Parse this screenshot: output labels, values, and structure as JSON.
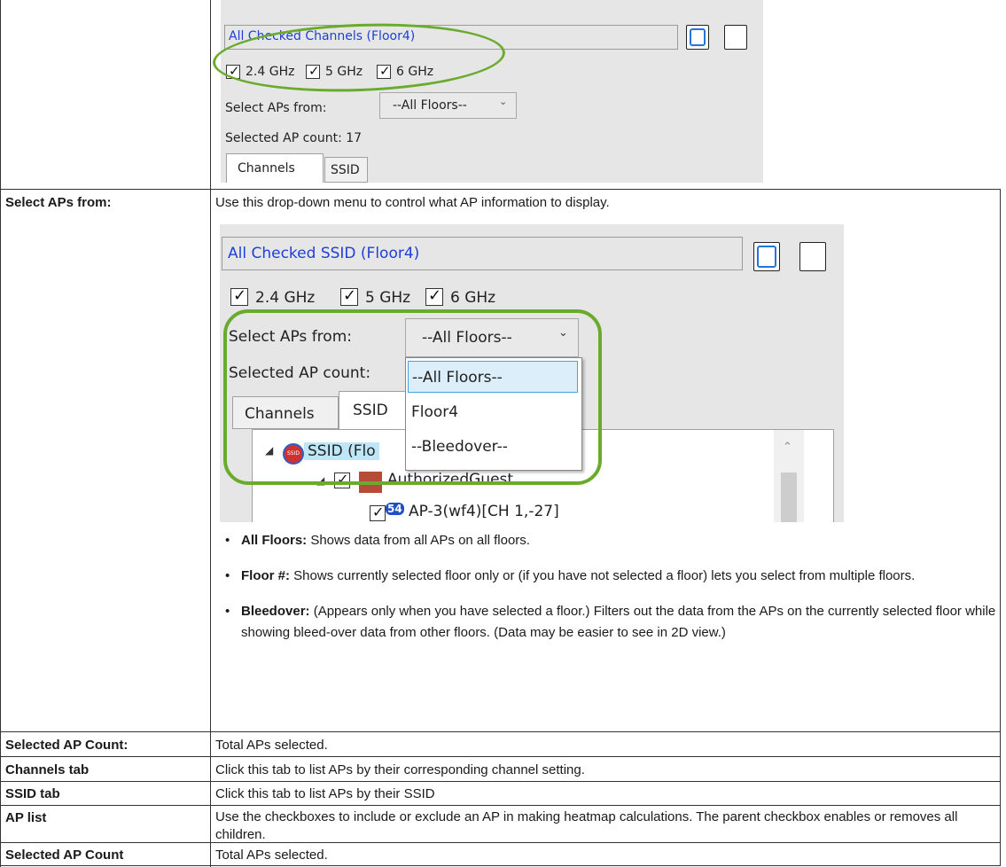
{
  "rows": [
    {
      "label": "",
      "desc": ""
    },
    {
      "label": "Select APs from:",
      "desc": "Use this drop-down menu to control what AP information to display."
    },
    {
      "label": "Selected AP Count:",
      "desc": "Total APs selected."
    },
    {
      "label": "Channels tab",
      "desc": "Click this tab to list APs by their corresponding channel setting."
    },
    {
      "label": "SSID tab",
      "desc": "Click this tab to list APs by their SSID"
    },
    {
      "label": "AP list",
      "desc": "Use the checkboxes to include or exclude an AP in making heatmap calculations. The parent checkbox enables or removes all children."
    },
    {
      "label": "Selected AP Count",
      "desc": "Total APs selected."
    }
  ],
  "shot1": {
    "title": "All Checked Channels (Floor4)",
    "bands": [
      "2.4 GHz",
      "5 GHz",
      "6 GHz"
    ],
    "select_label": "Select APs from:",
    "select_value": "--All Floors--",
    "count_label": "Selected AP count: 17",
    "tabs": [
      "Channels",
      "SSID"
    ]
  },
  "shot2": {
    "title": "All Checked SSID (Floor4)",
    "bands": [
      "2.4 GHz",
      "5 GHz",
      "6 GHz"
    ],
    "select_label": "Select APs from:",
    "select_value": "--All Floors--",
    "count_label": "Selected AP count:",
    "tabs": [
      "Channels",
      "SSID"
    ],
    "dropdown_options": [
      "--All Floors--",
      "Floor4",
      "--Bleedover--"
    ],
    "tree_root": "SSID (Flo",
    "tree_ssid_badge": "SSID",
    "tree_group": "AuthorizedGuest",
    "tree_ap_badge": "54",
    "tree_ap": "AP-3(wf4)[CH 1,-27]"
  },
  "bullets": [
    {
      "term": "All Floors:",
      "text": " Shows data from all APs on all floors."
    },
    {
      "term": "Floor #:",
      "text": " Shows currently selected floor only or (if you have not selected a floor) lets you select from multiple floors."
    },
    {
      "term": "Bleedover:",
      "text": " (Appears only when you have selected a floor.) Filters out the data from the APs on the currently selected floor while showing bleed-over data from other floors. (Data may be easier to see in 2D view.)"
    }
  ],
  "colors": {
    "highlight": "#6aab2e",
    "link_text": "#1f3fd6",
    "check_blue": "#2673d9"
  }
}
